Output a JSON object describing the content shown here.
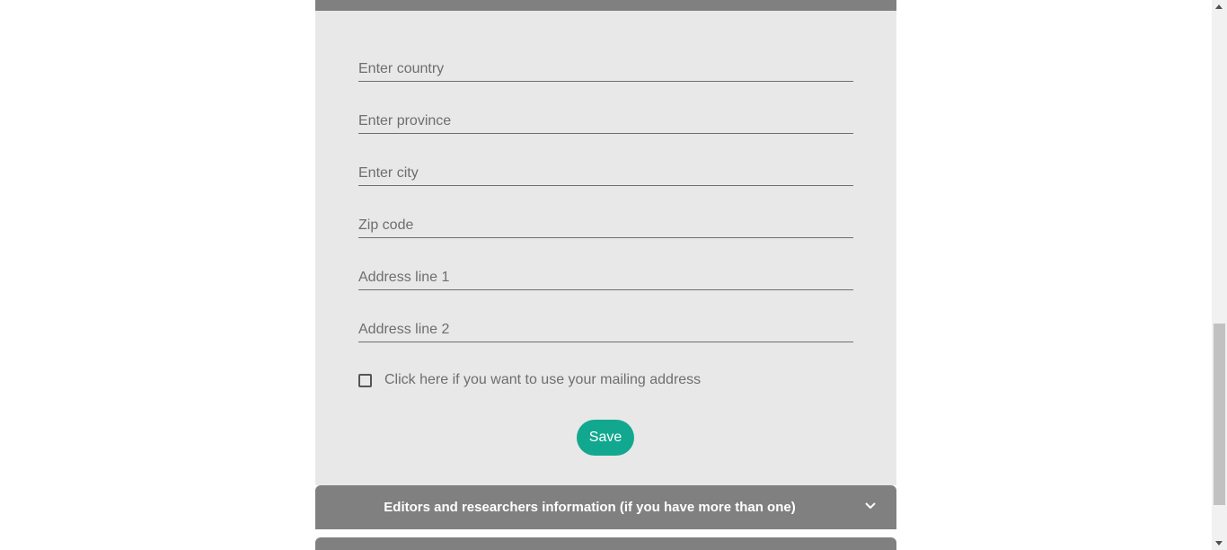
{
  "form": {
    "fields": [
      {
        "placeholder": "Enter country",
        "value": ""
      },
      {
        "placeholder": "Enter province",
        "value": ""
      },
      {
        "placeholder": "Enter city",
        "value": ""
      },
      {
        "placeholder": "Zip code",
        "value": ""
      },
      {
        "placeholder": "Address line 1",
        "value": ""
      },
      {
        "placeholder": "Address line 2",
        "value": ""
      }
    ],
    "checkbox_label": "Click here if you want to use your mailing address",
    "checkbox_checked": false,
    "save_label": "Save"
  },
  "accordion": {
    "title": "Editors and researchers information (if you have more than one)",
    "icon": "chevron-down-icon"
  },
  "colors": {
    "panel_bg": "#e8e8e8",
    "header_bg": "#808080",
    "accent": "#12a88f"
  }
}
